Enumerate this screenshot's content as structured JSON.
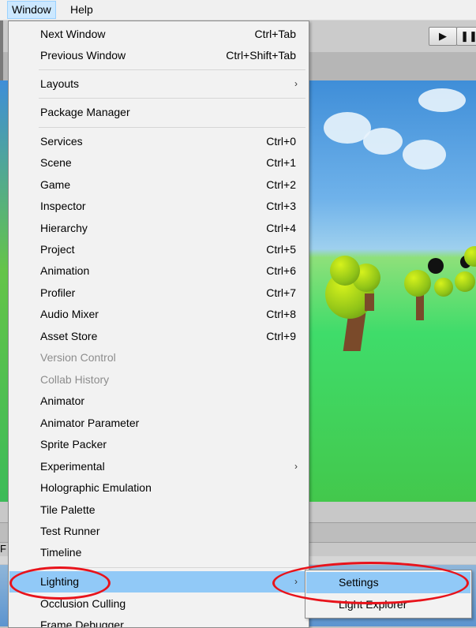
{
  "menubar": {
    "items": [
      {
        "label": "Window"
      },
      {
        "label": "Help"
      }
    ]
  },
  "toolbar": {
    "play_glyph": "▶",
    "pause_glyph": "❚❚"
  },
  "bottom": {
    "fragment": "F"
  },
  "window_menu": {
    "items": [
      {
        "label": "Next Window",
        "shortcut": "Ctrl+Tab"
      },
      {
        "label": "Previous Window",
        "shortcut": "Ctrl+Shift+Tab"
      },
      {
        "label": "Layouts",
        "submenu": true
      },
      {
        "label": "Package Manager"
      },
      {
        "label": "Services",
        "shortcut": "Ctrl+0"
      },
      {
        "label": "Scene",
        "shortcut": "Ctrl+1"
      },
      {
        "label": "Game",
        "shortcut": "Ctrl+2"
      },
      {
        "label": "Inspector",
        "shortcut": "Ctrl+3"
      },
      {
        "label": "Hierarchy",
        "shortcut": "Ctrl+4"
      },
      {
        "label": "Project",
        "shortcut": "Ctrl+5"
      },
      {
        "label": "Animation",
        "shortcut": "Ctrl+6"
      },
      {
        "label": "Profiler",
        "shortcut": "Ctrl+7"
      },
      {
        "label": "Audio Mixer",
        "shortcut": "Ctrl+8"
      },
      {
        "label": "Asset Store",
        "shortcut": "Ctrl+9"
      },
      {
        "label": "Version Control",
        "disabled": true
      },
      {
        "label": "Collab History",
        "disabled": true
      },
      {
        "label": "Animator"
      },
      {
        "label": "Animator Parameter"
      },
      {
        "label": "Sprite Packer"
      },
      {
        "label": "Experimental",
        "submenu": true
      },
      {
        "label": "Holographic Emulation"
      },
      {
        "label": "Tile Palette"
      },
      {
        "label": "Test Runner"
      },
      {
        "label": "Timeline"
      },
      {
        "label": "Lighting",
        "submenu": true,
        "highlighted": true
      },
      {
        "label": "Occlusion Culling"
      },
      {
        "label": "Frame Debugger"
      }
    ],
    "submenu_arrow": "›"
  },
  "lighting_submenu": {
    "items": [
      {
        "label": "Settings",
        "highlighted": true
      },
      {
        "label": "Light Explorer"
      }
    ]
  },
  "colors": {
    "highlight": "#91c9f7",
    "annotation": "#e8131b",
    "disabled_text": "#8d8d8d"
  }
}
